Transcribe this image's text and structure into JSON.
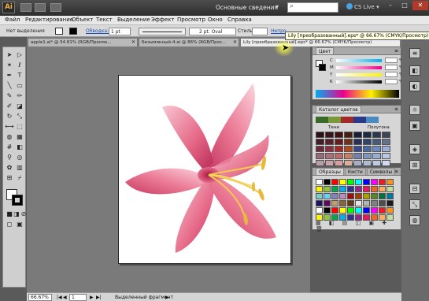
{
  "app": {
    "logo": "Ai",
    "workspace": "Основные сведения",
    "cs_live": "CS Live"
  },
  "menu": [
    "Файл",
    "Редактирование",
    "Объект",
    "Текст",
    "Выделение",
    "Эффект",
    "Просмотр",
    "Окно",
    "Справка"
  ],
  "control_bar": {
    "no_selection": "Нет выделения",
    "stroke_label": "Обводка:",
    "stroke_value": "1 pt",
    "brush_value": "2 pt. Oval",
    "style_label": "Стиль:",
    "opacity_label": "Непро"
  },
  "tabs": [
    {
      "label": "apple1.ai* @ 54.81% (RGB/Просмо...",
      "active": false
    },
    {
      "label": "Безымянный-4.ai @ 86% (RGB/Прос...",
      "active": false
    },
    {
      "label": "Lily [преобразованный].eps* @ 66.67% (CMYK/Просмотр)",
      "active": true
    }
  ],
  "tooltip": "Lily [преобразованный].eps* @ 66.67% (CMYK/Просмотр)",
  "status": {
    "zoom": "66.67%",
    "page": "1",
    "selection": "Выделенный фрагмент"
  },
  "color_panel": {
    "title": "Цвет",
    "channels": [
      {
        "label": "C",
        "gradient": [
          "#ffffff",
          "#00aeef"
        ]
      },
      {
        "label": "M",
        "gradient": [
          "#ffffff",
          "#ec008c"
        ]
      },
      {
        "label": "Y",
        "gradient": [
          "#ffffff",
          "#fff200"
        ]
      },
      {
        "label": "K",
        "gradient": [
          "#ffffff",
          "#000000"
        ]
      }
    ],
    "unit": "%"
  },
  "color_guide_panel": {
    "title": "Каталог цветов",
    "left_label": "Тени",
    "right_label": "Полутона"
  },
  "swatches_panel": {
    "tabs": [
      "Образцы",
      "Кисти",
      "Символы"
    ]
  },
  "colors": {
    "lily_light": "#f6b7c5",
    "lily_mid": "#e05a7c",
    "lily_dark": "#b8244f",
    "stamen": "#f2c94c",
    "guide_base": [
      "#6a2a3a",
      "#8a3040",
      "#a02a2a",
      "#b04a20",
      "#3a4a8a",
      "#4a6aa0",
      "#6a8ac0",
      "#9ab0d8"
    ],
    "swatch_colors": [
      "#ffffff",
      "#000000",
      "#ff0000",
      "#ffff00",
      "#00ff00",
      "#00ffff",
      "#0000ff",
      "#ff00ff",
      "#ec1c24",
      "#f7941d",
      "#fff200",
      "#8dc63f",
      "#00a651",
      "#00aeef",
      "#2e3192",
      "#92278f",
      "#ed145b",
      "#f26522",
      "#fbaf5d",
      "#c4df9b",
      "#7accc8",
      "#6dcff6",
      "#8781bd",
      "#bd8cbf",
      "#9e0b0f",
      "#a0410d",
      "#aba000",
      "#598527",
      "#007236",
      "#0076a3",
      "#1b1464",
      "#630460",
      "#c69c6d",
      "#8c6239",
      "#603913",
      "#e6e6e6",
      "#b3b3b3",
      "#808080",
      "#4d4d4d",
      "#1a1a1a"
    ]
  }
}
